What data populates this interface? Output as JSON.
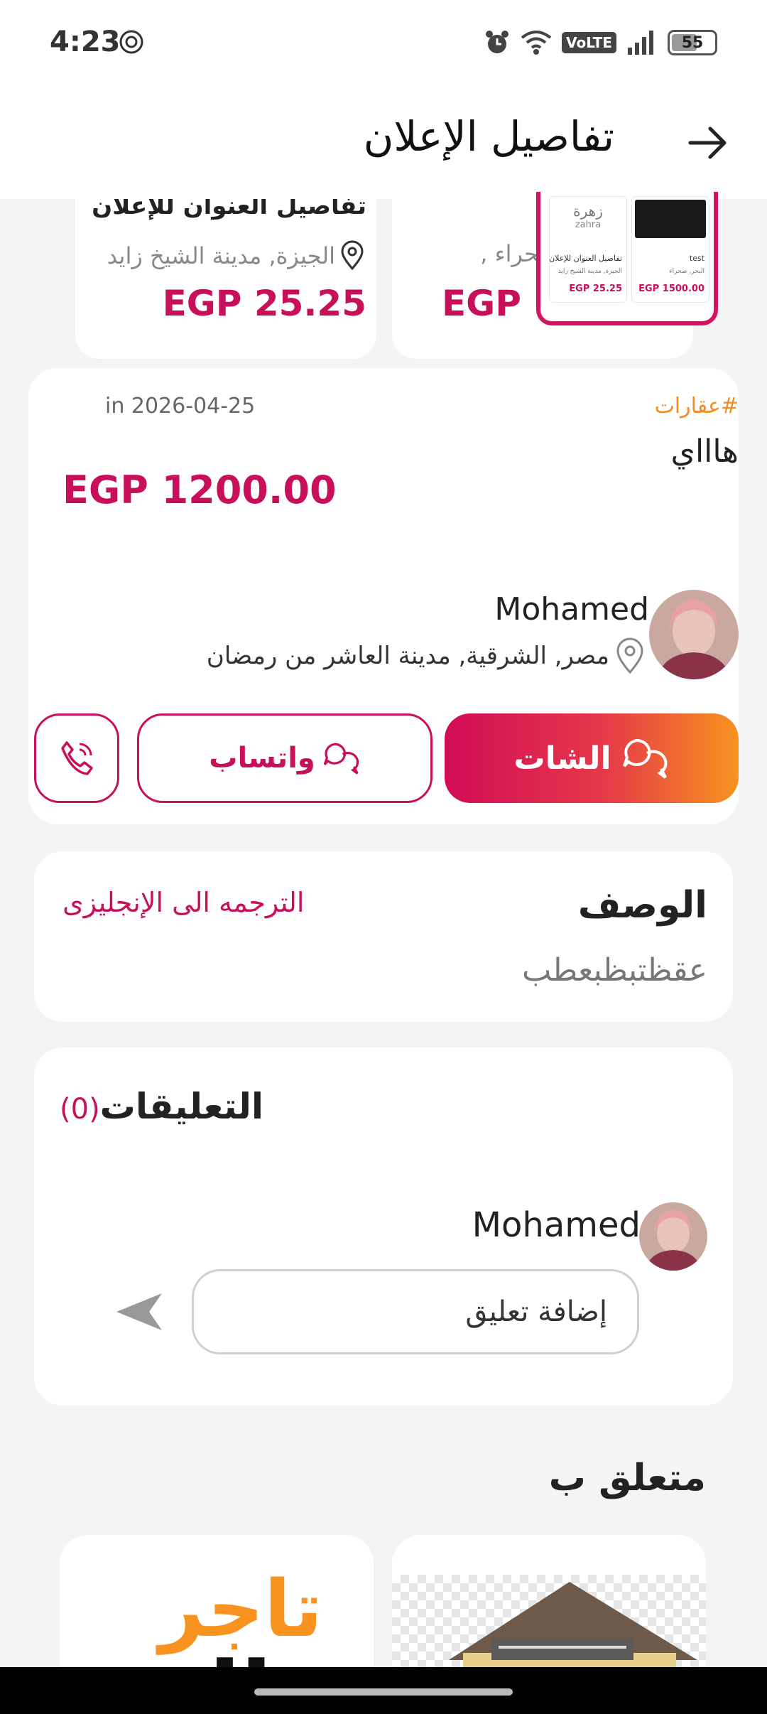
{
  "status_bar": {
    "time": "4:23",
    "volte": "VoLTE",
    "battery": "55"
  },
  "header": {
    "title": "تفاصيل الإعلان"
  },
  "carousel": {
    "left_card": {
      "title": "تفاصيل العنوان للإعلان",
      "location": "الجيزة, مدينة الشيخ زايد",
      "price": "EGP 25.25"
    },
    "right_card": {
      "location": "صحراء ,",
      "price": "EGP 1500.00"
    },
    "preview": {
      "card_a": {
        "name": "تفاصيل العنوان للإعلان",
        "location": "الجيزة, مدينة الشيخ زايد",
        "price": "EGP 25.25",
        "logo_text": "زهرة",
        "logo_sub": "zahra"
      },
      "card_b": {
        "name": "test",
        "location": "البحر, صحراء",
        "price": "EGP 1500.00"
      }
    }
  },
  "listing": {
    "category": "#عقارات",
    "date": "in 2026-04-25",
    "title": "هاااي",
    "price": "EGP 1200.00",
    "seller_name": "Mohamed",
    "seller_location": "مصر, الشرقية, مدينة العاشر من رمضان",
    "chat_label": "الشات",
    "whatsapp_label": "واتساب"
  },
  "description": {
    "title": "الوصف",
    "translate_link": "الترجمه الى الإنجليزى",
    "text": "عقظتبظبعطب"
  },
  "comments": {
    "title": "التعليقات",
    "count": "(0)",
    "commenter_name": "Mohamed",
    "input_placeholder": "إضافة تعليق"
  },
  "related": {
    "title": "متعلق ب",
    "brand_top": "تاجر",
    "brand_bottom": "الم"
  },
  "colors": {
    "accent": "#c8105a",
    "orange": "#f7931e",
    "background": "#f4f4f4"
  },
  "icons": [
    "openai-icon",
    "alarm-icon",
    "wifi-icon",
    "signal-icon",
    "battery-icon",
    "arrow-right-icon",
    "location-pin-icon",
    "chat-bubble-icon",
    "phone-icon",
    "send-icon"
  ]
}
